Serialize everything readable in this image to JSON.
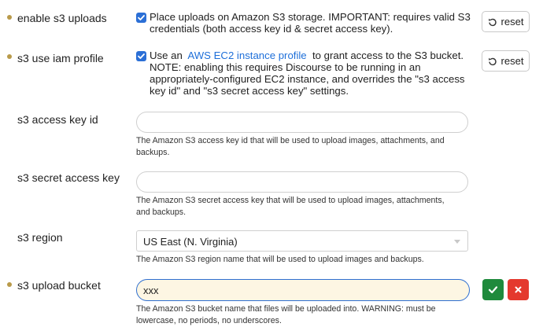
{
  "settings": {
    "enable_s3_uploads": {
      "label": "enable s3 uploads",
      "checked": true,
      "description": "Place uploads on Amazon S3 storage. IMPORTANT: requires valid S3 credentials (both access key id & secret access key).",
      "reset_label": "reset"
    },
    "s3_use_iam_profile": {
      "label": "s3 use iam profile",
      "checked": true,
      "desc_prefix": "Use an",
      "desc_link": "AWS EC2 instance profile",
      "desc_suffix": "to grant access to the S3 bucket. NOTE: enabling this requires Discourse to be running in an appropriately-configured EC2 instance, and overrides the \"s3 access key id\" and \"s3 secret access key\" settings.",
      "reset_label": "reset"
    },
    "s3_access_key_id": {
      "label": "s3 access key id",
      "value": "",
      "help": "The Amazon S3 access key id that will be used to upload images, attachments, and backups."
    },
    "s3_secret_access_key": {
      "label": "s3 secret access key",
      "value": "",
      "help": "The Amazon S3 secret access key that will be used to upload images, attachments, and backups."
    },
    "s3_region": {
      "label": "s3 region",
      "selected": "US East (N. Virginia)",
      "help": "The Amazon S3 region name that will be used to upload images and backups."
    },
    "s3_upload_bucket": {
      "label": "s3 upload bucket",
      "value": "xxx",
      "help": "The Amazon S3 bucket name that files will be uploaded into. WARNING: must be lowercase, no periods, no underscores."
    }
  },
  "colors": {
    "accent": "#2b6fd6",
    "modified_dot": "#b99a4a",
    "save_green": "#1f8a3c",
    "cancel_red": "#e4392e",
    "dirty_input_bg": "#fdf6e3"
  }
}
